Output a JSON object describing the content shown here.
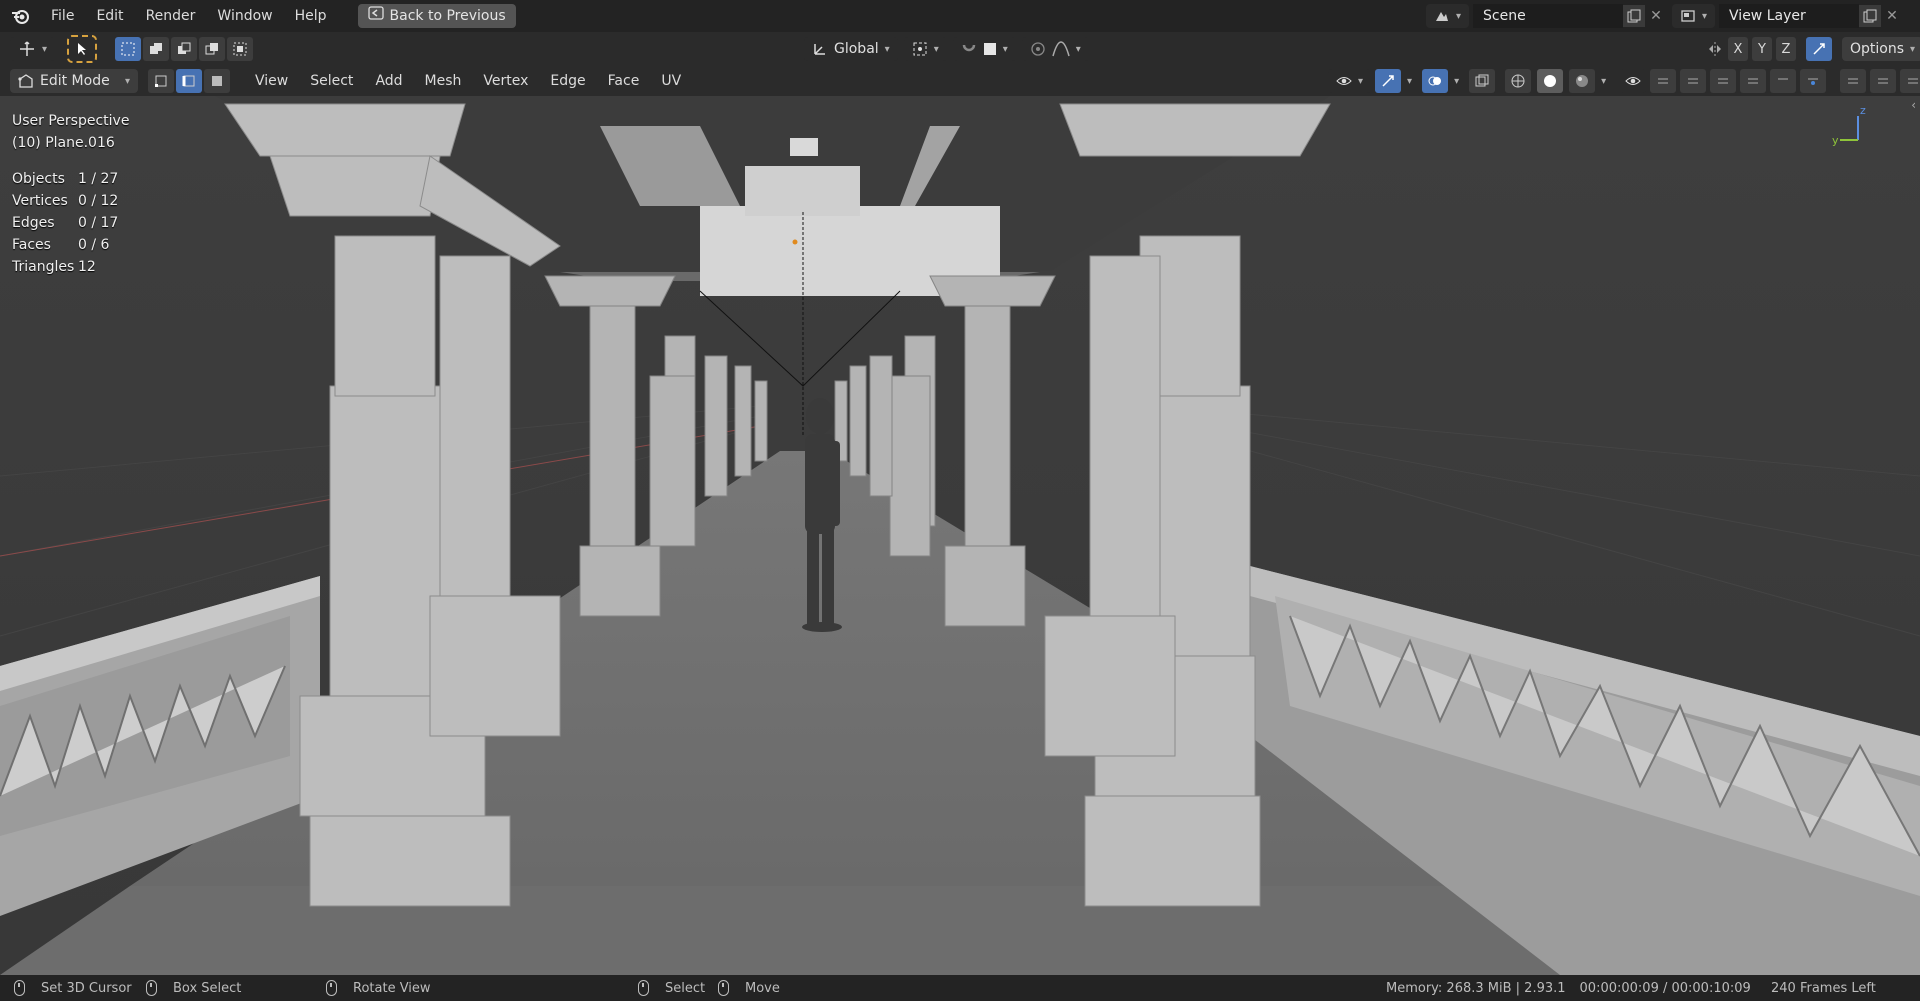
{
  "top_menu": {
    "items": [
      "File",
      "Edit",
      "Render",
      "Window",
      "Help"
    ],
    "back_button": "Back to Previous",
    "scene_label": "Scene",
    "view_layer_label": "View Layer"
  },
  "toolbar": {
    "orientation": "Global",
    "options": "Options",
    "axis_x": "X",
    "axis_y": "Y",
    "axis_z": "Z"
  },
  "header": {
    "mode": "Edit Mode",
    "menus": [
      "View",
      "Select",
      "Add",
      "Mesh",
      "Vertex",
      "Edge",
      "Face",
      "UV"
    ]
  },
  "viewport": {
    "perspective": "User Perspective",
    "object_name": "(10) Plane.016",
    "stats": [
      {
        "label": "Objects",
        "value": "1 / 27"
      },
      {
        "label": "Vertices",
        "value": "0 / 12"
      },
      {
        "label": "Edges",
        "value": "0 / 17"
      },
      {
        "label": "Faces",
        "value": "0 / 6"
      },
      {
        "label": "Triangles",
        "value": "12"
      }
    ],
    "gizmo_y": "y",
    "gizmo_z": "z"
  },
  "status": {
    "set_cursor": "Set 3D Cursor",
    "box_select": "Box Select",
    "rotate_view": "Rotate View",
    "select": "Select",
    "move": "Move",
    "memory": "Memory: 268.3 MiB | 2.93.1",
    "time": "00:00:00:09 / 00:00:10:09",
    "frames_left": "240 Frames Left"
  },
  "colors": {
    "accent": "#4772b3",
    "header_bg": "#232323"
  }
}
